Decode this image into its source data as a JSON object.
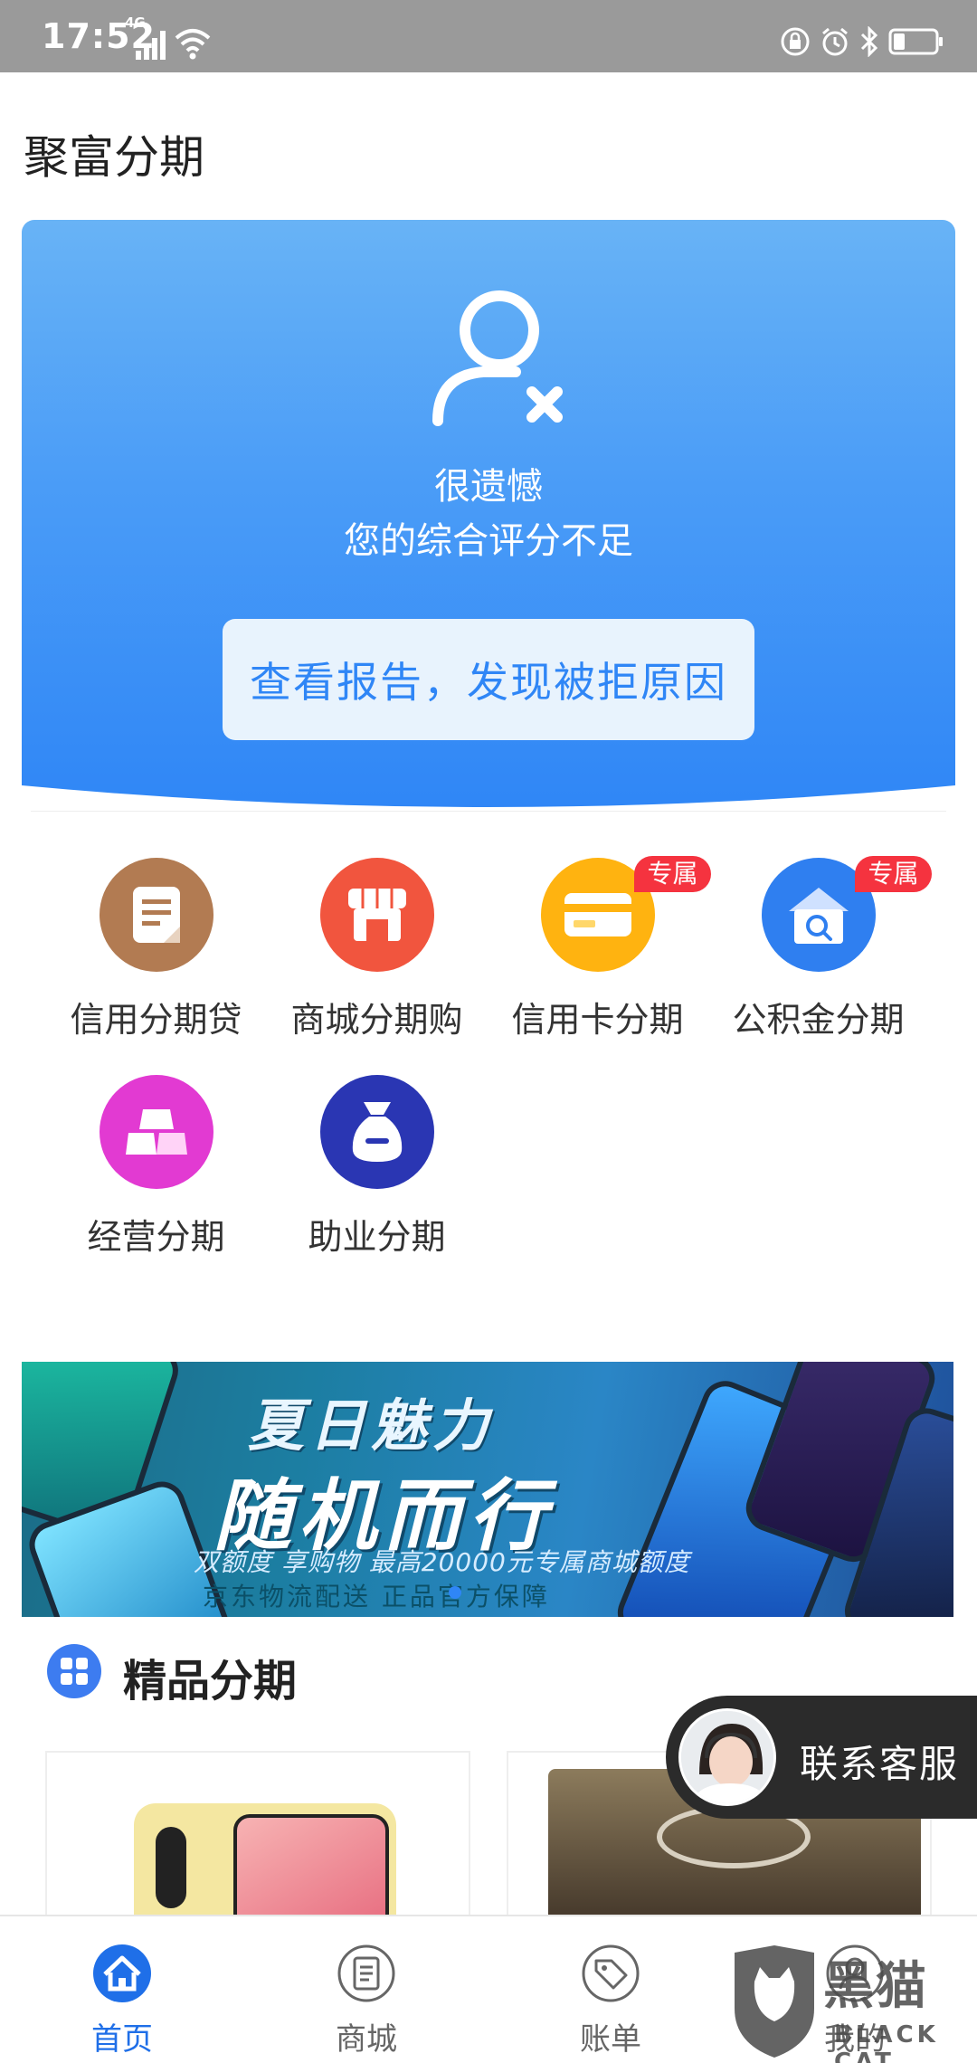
{
  "status_bar": {
    "time": "17:52",
    "network": "4G"
  },
  "app": {
    "title": "聚富分期"
  },
  "hero": {
    "line1": "很遗憾",
    "line2": "您的综合评分不足",
    "button_label": "查看报告，发现被拒原因",
    "gradient_colors": [
      "#68b3f6",
      "#2f86f6"
    ]
  },
  "services": [
    {
      "label": "信用分期贷",
      "icon": "document-icon",
      "color": "#b27b52"
    },
    {
      "label": "商城分期购",
      "icon": "store-icon",
      "color": "#f1553e"
    },
    {
      "label": "信用卡分期",
      "icon": "credit-card-icon",
      "color": "#ffb310",
      "badge": "专属"
    },
    {
      "label": "公积金分期",
      "icon": "house-search-icon",
      "color": "#2f7ff0",
      "badge": "专属"
    },
    {
      "label": "经营分期",
      "icon": "gold-bars-icon",
      "color": "#e23ad2"
    },
    {
      "label": "助业分期",
      "icon": "money-bag-icon",
      "color": "#2a36b3"
    }
  ],
  "banner": {
    "title1": "夏日魅力",
    "title2": "随机而行",
    "subtitle": "双额度 享购物 最高20000元专属商城额度",
    "subtitle2": "京东物流配送  正品官方保障"
  },
  "section": {
    "title": "精品分期",
    "icon": "grid-icon"
  },
  "customer_service": {
    "label": "联系客服"
  },
  "tabbar": {
    "items": [
      {
        "label": "首页",
        "icon": "home-icon",
        "active": true
      },
      {
        "label": "商城",
        "icon": "list-icon",
        "active": false
      },
      {
        "label": "账单",
        "icon": "tag-icon",
        "active": false
      },
      {
        "label": "我的",
        "icon": "user-icon",
        "active": false
      }
    ],
    "active_color": "#1f6fe8"
  },
  "watermark": {
    "text": "黑猫",
    "sub": "BLACK CAT"
  }
}
